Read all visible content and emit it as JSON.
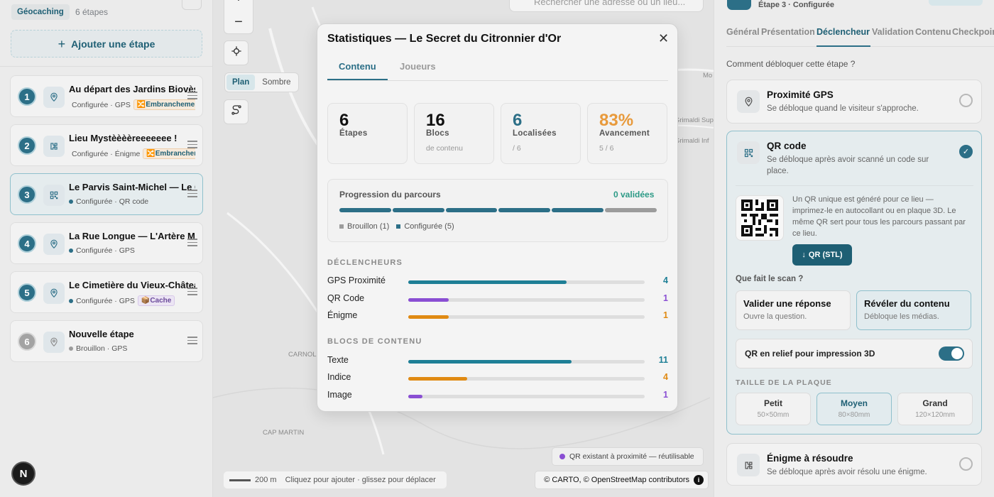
{
  "sidebar": {
    "tag": "Géocaching",
    "step_count": "6 étapes",
    "add_label": "Ajouter une étape",
    "steps": [
      {
        "num": "1",
        "title": "Au départ des Jardins Biovès",
        "meta": "Configurée · GPS",
        "badge": "🔀Embranchement",
        "badge_kind": "orange",
        "icon": "pin-icon",
        "status": "configured"
      },
      {
        "num": "2",
        "title": "Lieu Mystèèèèreeeeeee !",
        "meta": "Configurée · Énigme",
        "badge": "🔀Embranchement",
        "badge_kind": "orange",
        "icon": "puzzle-icon",
        "status": "configured"
      },
      {
        "num": "3",
        "title": "Le Parvis Saint-Michel — Le Cœur",
        "meta": "Configurée · QR code",
        "badge": "",
        "badge_kind": "",
        "icon": "qr-icon",
        "status": "configured",
        "active": true
      },
      {
        "num": "4",
        "title": "La Rue Longue — L'Artère Médiévale",
        "meta": "Configurée · GPS",
        "badge": "",
        "badge_kind": "",
        "icon": "pin-icon",
        "status": "configured"
      },
      {
        "num": "5",
        "title": "Le Cimetière du Vieux-Château",
        "meta": "Configurée · GPS",
        "badge": "📦Cache",
        "badge_kind": "purple",
        "icon": "pin-icon",
        "status": "configured"
      },
      {
        "num": "6",
        "title": "Nouvelle étape",
        "meta": "Brouillon · GPS",
        "badge": "",
        "badge_kind": "",
        "icon": "pin-icon",
        "status": "draft"
      }
    ],
    "user_initial": "N"
  },
  "map": {
    "style_options": [
      "Plan",
      "Sombre"
    ],
    "selected_style": "Plan",
    "search_placeholder": "Rechercher une adresse ou un lieu...",
    "labels": [
      "Mo",
      "Grimaldi Sup",
      "Grimaldi Inf",
      "CARNOLÈS",
      "CAP MARTIN"
    ],
    "scale": "200 m",
    "hint": "Cliquez pour ajouter · glissez pour déplacer",
    "qr_nearby": "QR existant à proximité — réutilisable",
    "attribution": "© CARTO, © OpenStreetMap contributors"
  },
  "modal": {
    "title": "Statistiques — Le Secret du Citronnier d'Or",
    "tabs": [
      "Contenu",
      "Joueurs"
    ],
    "active_tab": "Contenu",
    "stats": [
      {
        "value": "6",
        "label": "Étapes",
        "sub": "",
        "color": "#111111"
      },
      {
        "value": "16",
        "label": "Blocs",
        "sub": "de contenu",
        "color": "#111111"
      },
      {
        "value": "6",
        "label": "Localisées",
        "sub": "/ 6",
        "color": "#2c6f87"
      },
      {
        "value": "83%",
        "label": "Avancement",
        "sub": "5 / 6",
        "color": "#e89a3c"
      }
    ],
    "progress": {
      "title": "Progression du parcours",
      "validated": "0 validées",
      "legend": [
        "Brouillon (1)",
        "Configurée (5)"
      ]
    },
    "triggers_heading": "DÉCLENCHEURS",
    "triggers": [
      {
        "label": "GPS Proximité",
        "count": 4,
        "fraction": 0.67,
        "color": "#1e7f96"
      },
      {
        "label": "QR Code",
        "count": 1,
        "fraction": 0.17,
        "color": "#8a4fd3"
      },
      {
        "label": "Énigme",
        "count": 1,
        "fraction": 0.17,
        "color": "#e08a13"
      }
    ],
    "blocks_heading": "BLOCS DE CONTENU",
    "blocks": [
      {
        "label": "Texte",
        "count": 11,
        "fraction": 0.69,
        "color": "#1e7f96"
      },
      {
        "label": "Indice",
        "count": 4,
        "fraction": 0.25,
        "color": "#e08a13"
      },
      {
        "label": "Image",
        "count": 1,
        "fraction": 0.06,
        "color": "#8a4fd3"
      }
    ]
  },
  "panel": {
    "step_info": "Étape 3 · Configurée",
    "tabs": [
      "Général",
      "Présentation",
      "Déclencheur",
      "Validation",
      "Contenu",
      "Checkpoint"
    ],
    "active_tab": "Déclencheur",
    "question": "Comment débloquer cette étape ?",
    "gps": {
      "title": "Proximité GPS",
      "desc": "Se débloque quand le visiteur s'approche."
    },
    "qr": {
      "title": "QR code",
      "desc": "Se débloque après avoir scanné un code sur place.",
      "info": "Un QR unique est généré pour ce lieu — imprimez-le en autocollant ou en plaque 3D. Le même QR sert pour tous les parcours passant par ce lieu.",
      "download": "QR (STL)",
      "scan_question": "Que fait le scan ?",
      "options": [
        {
          "title": "Valider une réponse",
          "desc": "Ouvre la question."
        },
        {
          "title": "Révéler du contenu",
          "desc": "Débloque les médias."
        }
      ],
      "relief": "QR en relief pour impression 3D",
      "relief_on": true,
      "size_heading": "TAILLE DE LA PLAQUE",
      "sizes": [
        {
          "title": "Petit",
          "desc": "50×50mm"
        },
        {
          "title": "Moyen",
          "desc": "80×80mm"
        },
        {
          "title": "Grand",
          "desc": "120×120mm"
        }
      ]
    },
    "enigme": {
      "title": "Énigme à résoudre",
      "desc": "Se débloque après avoir résolu une énigme."
    }
  }
}
